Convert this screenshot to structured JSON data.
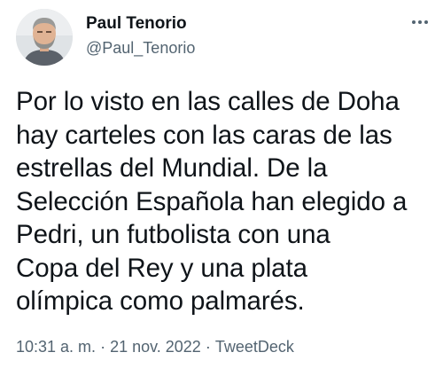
{
  "author": {
    "display_name": "Paul Tenorio",
    "handle": "@Paul_Tenorio",
    "avatar_icon": "profile-photo"
  },
  "more_icon": "more-horizontal-icon",
  "tweet": {
    "lines": [
      "Por lo visto en las calles de Doha",
      "hay carteles con las caras de las",
      "estrellas del Mundial. De la",
      "Selección Española han elegido a",
      "Pedri, un futbolista con una",
      "Copa del Rey y una plata",
      "olímpica como palmarés."
    ]
  },
  "meta": {
    "time": "10:31 a. m.",
    "separator": "·",
    "date": "21 nov. 2022",
    "source": "TweetDeck"
  },
  "colors": {
    "text": "#0f1419",
    "secondary": "#536471",
    "background": "#ffffff"
  }
}
